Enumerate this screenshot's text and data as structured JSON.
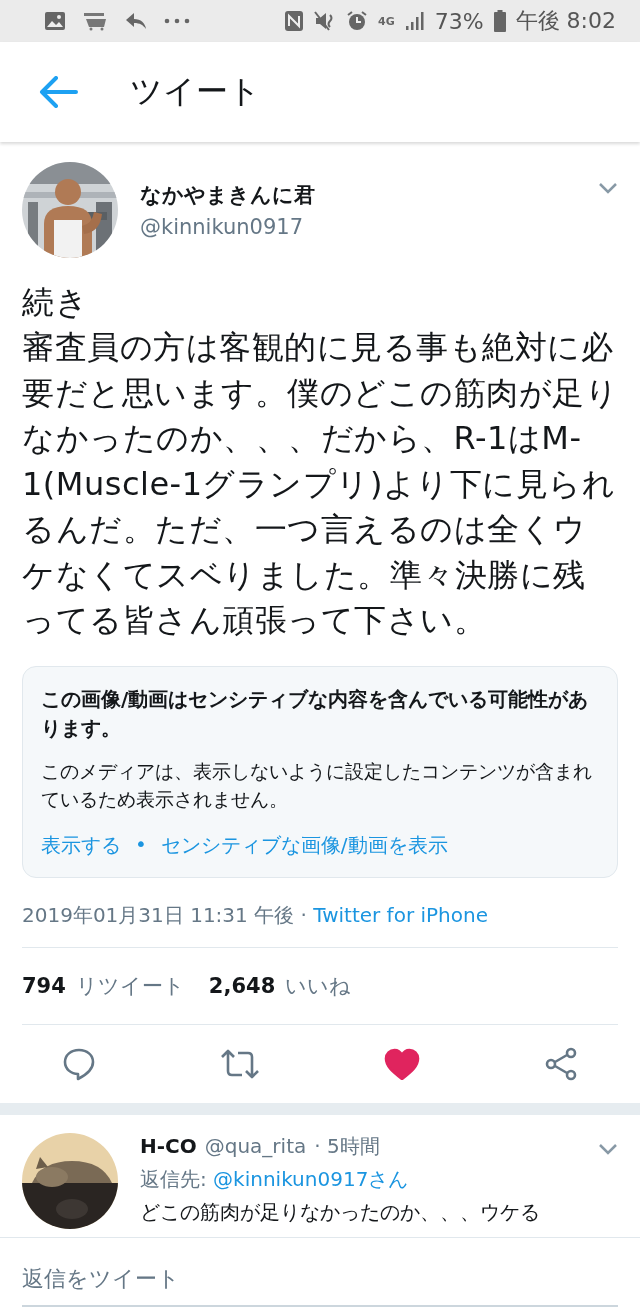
{
  "status_bar": {
    "network": "4G",
    "battery": "73%",
    "time": "午後 8:02"
  },
  "header": {
    "title": "ツイート"
  },
  "tweet": {
    "name": "なかやまきんに君",
    "handle": "@kinnikun0917",
    "lines": [
      "続き",
      "審査員の方は客観的に見る事も絶対に必要だと思います。僕のどこの筋肉が足りなかったのか、、、だから、R-1はM-1(Muscle-1グランプリ)より下に見られるんだ。ただ、一つ言えるのは全くウケなくてスベりました。準々決勝に残ってる皆さん頑張って下さい。"
    ],
    "sensitive_notice": {
      "title": "この画像/動画はセンシティブな内容を含んでいる可能性があります。",
      "body": "このメディアは、表示しないように設定したコンテンツが含まれているため表示されません。",
      "links": [
        "表示する",
        "センシティブな画像/動画を表示"
      ],
      "link_separator": "•"
    },
    "timestamp": "2019年01月31日 11:31 午後 · ",
    "source": "Twitter for iPhone",
    "retweets": "794",
    "retweets_label": "リツイート",
    "likes": "2,648",
    "likes_label": "いいね",
    "liked": true
  },
  "reply": {
    "name": "H-CO",
    "handle": "@qua_rita",
    "time": " · 5時間",
    "reply_to_label": "返信先: ",
    "reply_to": "@kinnikun0917さん",
    "text": "どこの筋肉が足りなかったのか、、、ウケる"
  },
  "compose": {
    "placeholder": "返信をツイート"
  }
}
